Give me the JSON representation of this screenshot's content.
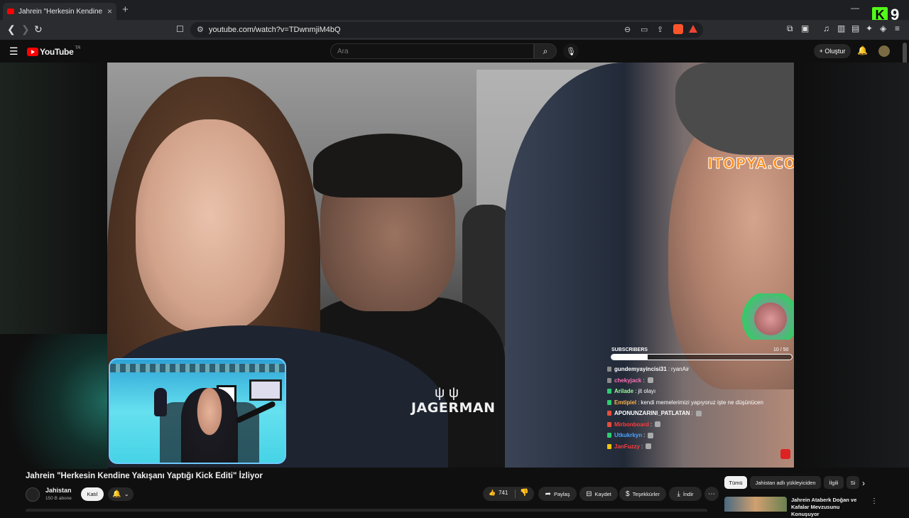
{
  "browser": {
    "tab_title": "Jahrein \"Herkesin Kendine Yakışa",
    "tab_close": "×",
    "new_tab": "+",
    "url": "youtube.com/watch?v=TDwnmjiM4bQ",
    "kick_badge": "K",
    "kick_number": "9"
  },
  "youtube": {
    "logo_text": "YouTube",
    "country_code": "TR",
    "search_placeholder": "Ara",
    "create_label": "+ Oluştur"
  },
  "video_overlay": {
    "sponsor_logo": "ITOPYA.COM",
    "jagerman_text": "JAGERMAN",
    "subs_label": "SUBSCRIBERS",
    "subs_current": 10,
    "subs_goal": 50,
    "subs_text": "10 / 50",
    "chat": [
      {
        "user": "gundemyayincisi31",
        "text": "ryanAir",
        "user_color": "#ffffff",
        "badge_color": "#8a8a8a",
        "emote": false
      },
      {
        "user": "chekyjack",
        "text": "",
        "user_color": "#ff6fb5",
        "badge_color": "#8a8a8a",
        "emote": true
      },
      {
        "user": "Arilade",
        "text": "jit olayı",
        "user_color": "#9dff9d",
        "badge_color": "#2ecc71",
        "emote": false
      },
      {
        "user": "Emtipiel",
        "text": "kendi memelerimizi yapıyoruz işte ne düşünücen",
        "user_color": "#ffb347",
        "badge_color": "#2ecc71",
        "emote": false
      },
      {
        "user": "APONUNZARINI_PATLATAN",
        "text": "",
        "user_color": "#ffffff",
        "badge_color": "#e74c3c",
        "emote": true
      },
      {
        "user": "Mirbonboard",
        "text": "",
        "user_color": "#ff3b3b",
        "badge_color": "#e74c3c",
        "emote": true
      },
      {
        "user": "Utkukrkyn",
        "text": "",
        "user_color": "#4da3ff",
        "badge_color": "#2ecc71",
        "emote": true
      },
      {
        "user": "JanFuzzy",
        "text": "",
        "user_color": "#ff3b3b",
        "badge_color": "#f1c40f",
        "emote": true
      }
    ]
  },
  "video_info": {
    "title": "Jahrein \"Herkesin Kendine Yakışanı Yaptığı Kick Editi\" İzliyor",
    "channel_name": "Jahistan",
    "channel_subs": "150 B abone",
    "join_label": "Katıl",
    "likes": "741",
    "share_label": "Paylaş",
    "save_label": "Kaydet",
    "thanks_label": "Teşekkürler",
    "download_label": "İndir"
  },
  "sidebar": {
    "chips": [
      "Tümü",
      "Jahistan adlı yükleyiciden",
      "İlgili",
      "Si"
    ],
    "recommended": {
      "title": "Jahrein Ataberk Doğan ve Kafalar Mevzusunu Konuşuyor"
    }
  }
}
